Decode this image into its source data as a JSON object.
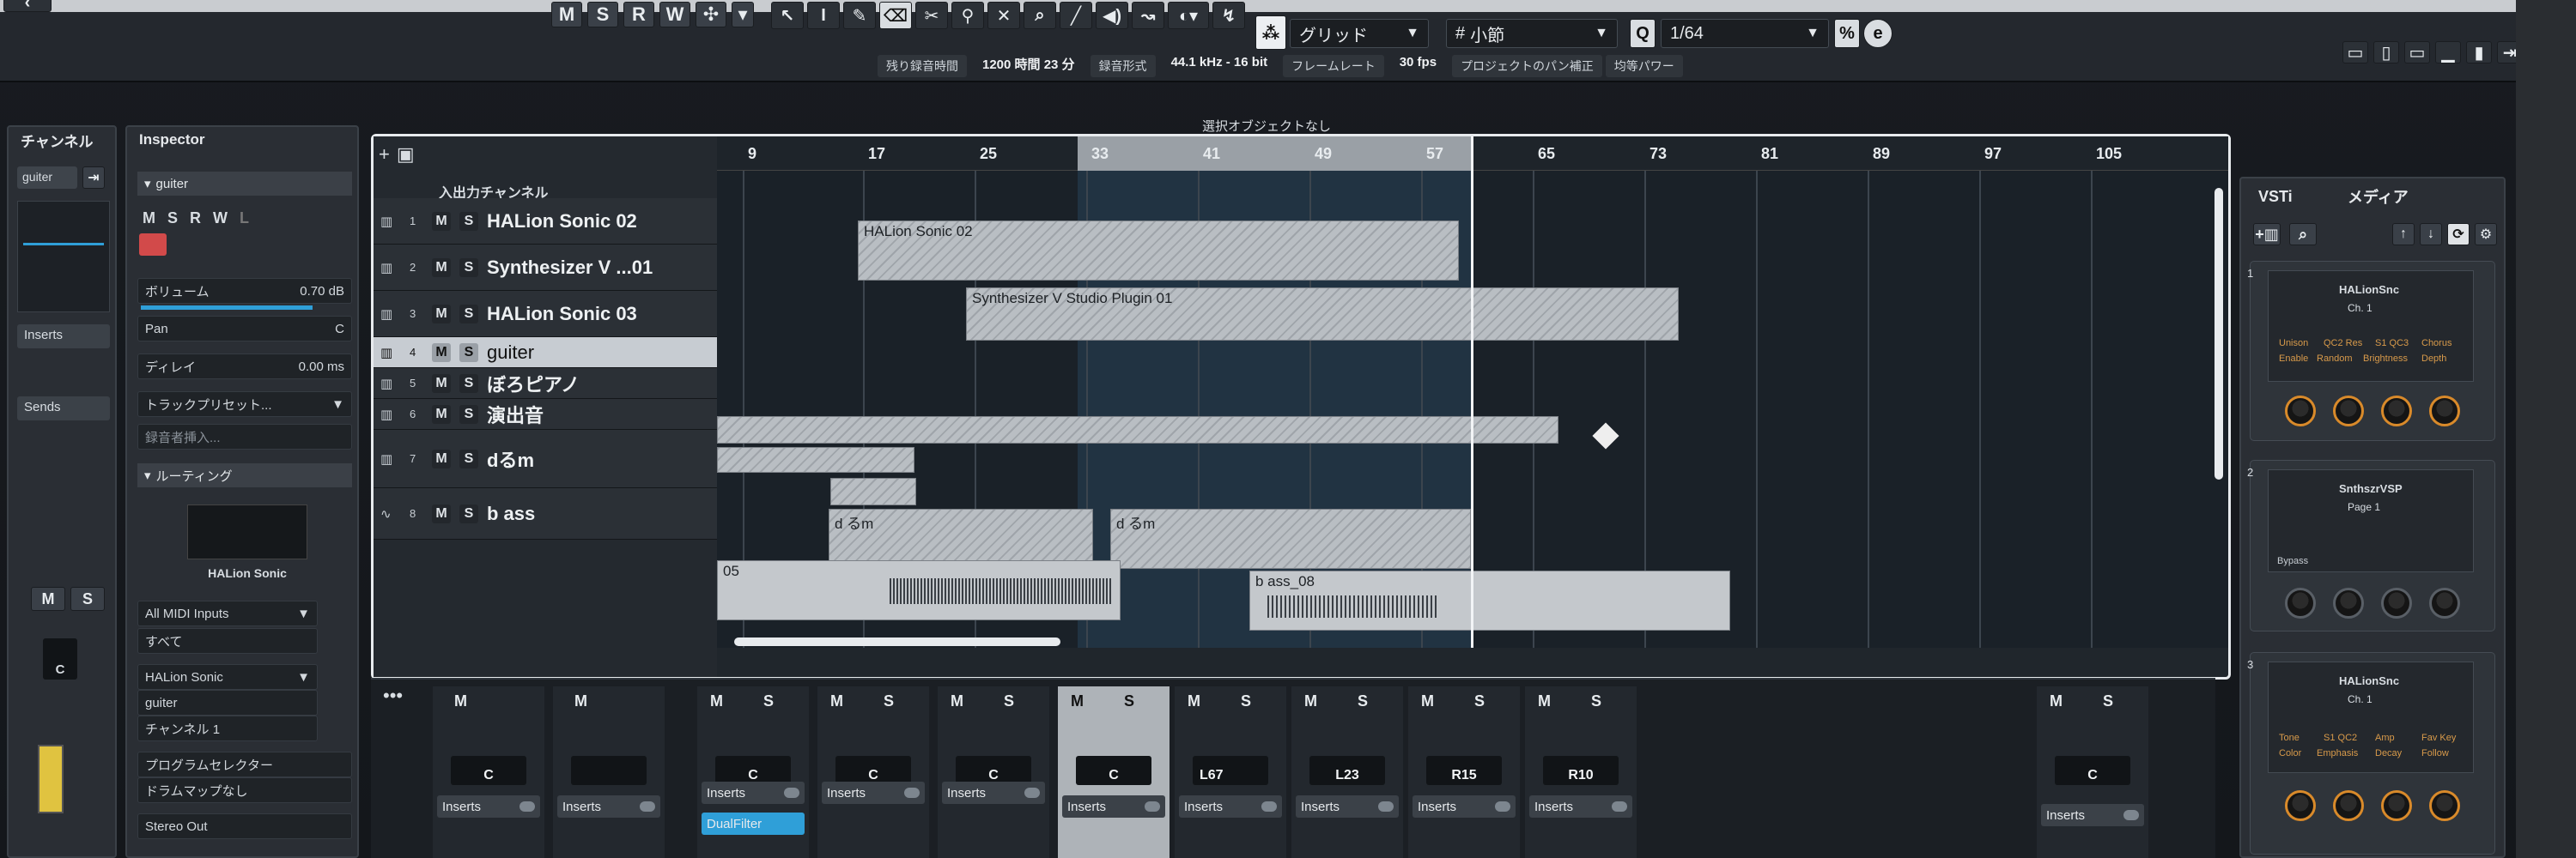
{
  "toolbar": {
    "mode_buttons": [
      "M",
      "S",
      "R",
      "W"
    ],
    "grid_type": "グリッド",
    "grid_unit": "小節",
    "quantize": "1/64",
    "status": {
      "record_time_label": "残り録音時間",
      "record_time_value": "1200 時間 23 分",
      "format_label": "録音形式",
      "format_value": "44.1 kHz - 16 bit",
      "framerate_label": "フレームレート",
      "framerate_value": "30 fps",
      "pan_label": "プロジェクトのパン補正",
      "pan_value": "均等パワー"
    },
    "info_line": "選択オブジェクトなし"
  },
  "channel_panel": {
    "tab": "チャンネル",
    "name": "guiter",
    "inserts": "Inserts",
    "sends": "Sends",
    "m": "M",
    "s": "S",
    "pan": "C"
  },
  "inspector": {
    "tab": "Inspector",
    "track_name": "guiter",
    "buttons": [
      "M",
      "S",
      "R",
      "W",
      "L"
    ],
    "volume_label": "ボリューム",
    "volume_value": "0.70 dB",
    "pan_label": "Pan",
    "pan_value": "C",
    "delay_label": "ディレイ",
    "delay_value": "0.00 ms",
    "preset": "トラックプリセット...",
    "insert_placeholder": "録音者挿入...",
    "routing_label": "ルーティング",
    "instrument_name": "HALion Sonic",
    "midi_input": "All MIDI Inputs",
    "midi_channel_all": "すべて",
    "output": "HALion Sonic",
    "output_track": "guiter",
    "channel": "チャンネル 1",
    "program_selector": "プログラムセレクター",
    "drum_map": "ドラムマップなし",
    "stereo_out": "Stereo Out"
  },
  "tracks": {
    "header": "入出力チャンネル",
    "items": [
      {
        "num": "1",
        "name": "HALion Sonic 02",
        "type": "inst"
      },
      {
        "num": "2",
        "name": "Synthesizer V ...01",
        "type": "inst"
      },
      {
        "num": "3",
        "name": "HALion Sonic 03",
        "type": "inst"
      },
      {
        "num": "4",
        "name": "guiter",
        "type": "midi"
      },
      {
        "num": "5",
        "name": "ぼろピアノ",
        "type": "midi"
      },
      {
        "num": "6",
        "name": "演出音",
        "type": "midi"
      },
      {
        "num": "7",
        "name": "dるm",
        "type": "inst"
      },
      {
        "num": "8",
        "name": "b ass",
        "type": "audio"
      }
    ]
  },
  "ruler": [
    "9",
    "17",
    "25",
    "33",
    "41",
    "49",
    "57",
    "65",
    "73",
    "81",
    "89",
    "97",
    "105"
  ],
  "events": [
    {
      "label": "HALion Sonic 02",
      "track": 0
    },
    {
      "label": "Synthesizer V Studio Plugin 01",
      "track": 1
    },
    {
      "label": "d るm",
      "track": 6
    },
    {
      "label": "d るm",
      "track": 6
    },
    {
      "label": "05",
      "track": 7
    },
    {
      "label": "b ass_08",
      "track": 7
    }
  ],
  "mixer": {
    "inserts_label": "Inserts",
    "plugin": "DualFilter",
    "strips": [
      {
        "pan": "C"
      },
      {
        "pan": ""
      },
      {
        "pan": "C"
      },
      {
        "pan": "C"
      },
      {
        "pan": "C"
      },
      {
        "pan": "C"
      },
      {
        "pan": "L67"
      },
      {
        "pan": "L23"
      },
      {
        "pan": "R15"
      },
      {
        "pan": "R10"
      },
      {
        "pan": "C"
      }
    ]
  },
  "vsti": {
    "tab_vsti": "VSTi",
    "tab_media": "メディア",
    "slots": [
      {
        "num": "1",
        "name": "HALionSnc",
        "channel": "Ch. 1",
        "params": [
          "Unison",
          "QC2 Res",
          "S1 QC3",
          "Chorus",
          "Enable",
          "Random",
          "Brightness",
          "Depth"
        ]
      },
      {
        "num": "2",
        "name": "SnthszrVSP",
        "channel": "Page 1",
        "params": [
          "Bypass"
        ]
      },
      {
        "num": "3",
        "name": "HALionSnc",
        "channel": "Ch. 1",
        "params": [
          "Tone",
          "S1 QC2",
          "Amp",
          "Fav Key",
          "Color",
          "Emphasis",
          "Decay",
          "Follow"
        ]
      }
    ]
  },
  "colors": {
    "accent_blue": "#2f9fd8",
    "selected_track": "#c7ccd2",
    "event_gray": "#b9bec3",
    "knob_orange": "#d98a2a"
  }
}
